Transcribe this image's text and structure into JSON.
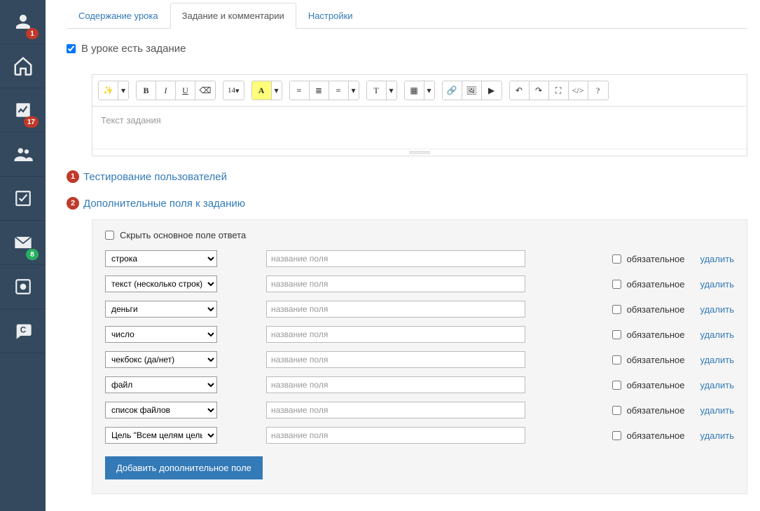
{
  "sidebar": {
    "badges": {
      "profile": "1",
      "chart": "17",
      "mail": "8"
    }
  },
  "tabs": [
    {
      "label": "Содержание урока"
    },
    {
      "label": "Задание и комментарии"
    },
    {
      "label": "Настройки"
    }
  ],
  "lesson_has_task": "В уроке есть задание",
  "editor": {
    "placeholder": "Текст задания",
    "font_size": "14"
  },
  "sections": {
    "testing": "Тестирование пользователей",
    "extra_fields": "Дополнительные поля к заданию"
  },
  "panel": {
    "hide_main": "Скрыть основное поле ответа",
    "required_label": "обязательное",
    "delete_label": "удалить",
    "name_placeholder": "название поля",
    "add_button": "Добавить дополнительное поле",
    "rows": [
      {
        "type": "строка"
      },
      {
        "type": "текст (несколько строк)"
      },
      {
        "type": "деньги"
      },
      {
        "type": "число"
      },
      {
        "type": "чекбокс (да/нет)"
      },
      {
        "type": "файл"
      },
      {
        "type": "список файлов"
      },
      {
        "type": "Цель \"Всем целям цель\""
      }
    ]
  }
}
